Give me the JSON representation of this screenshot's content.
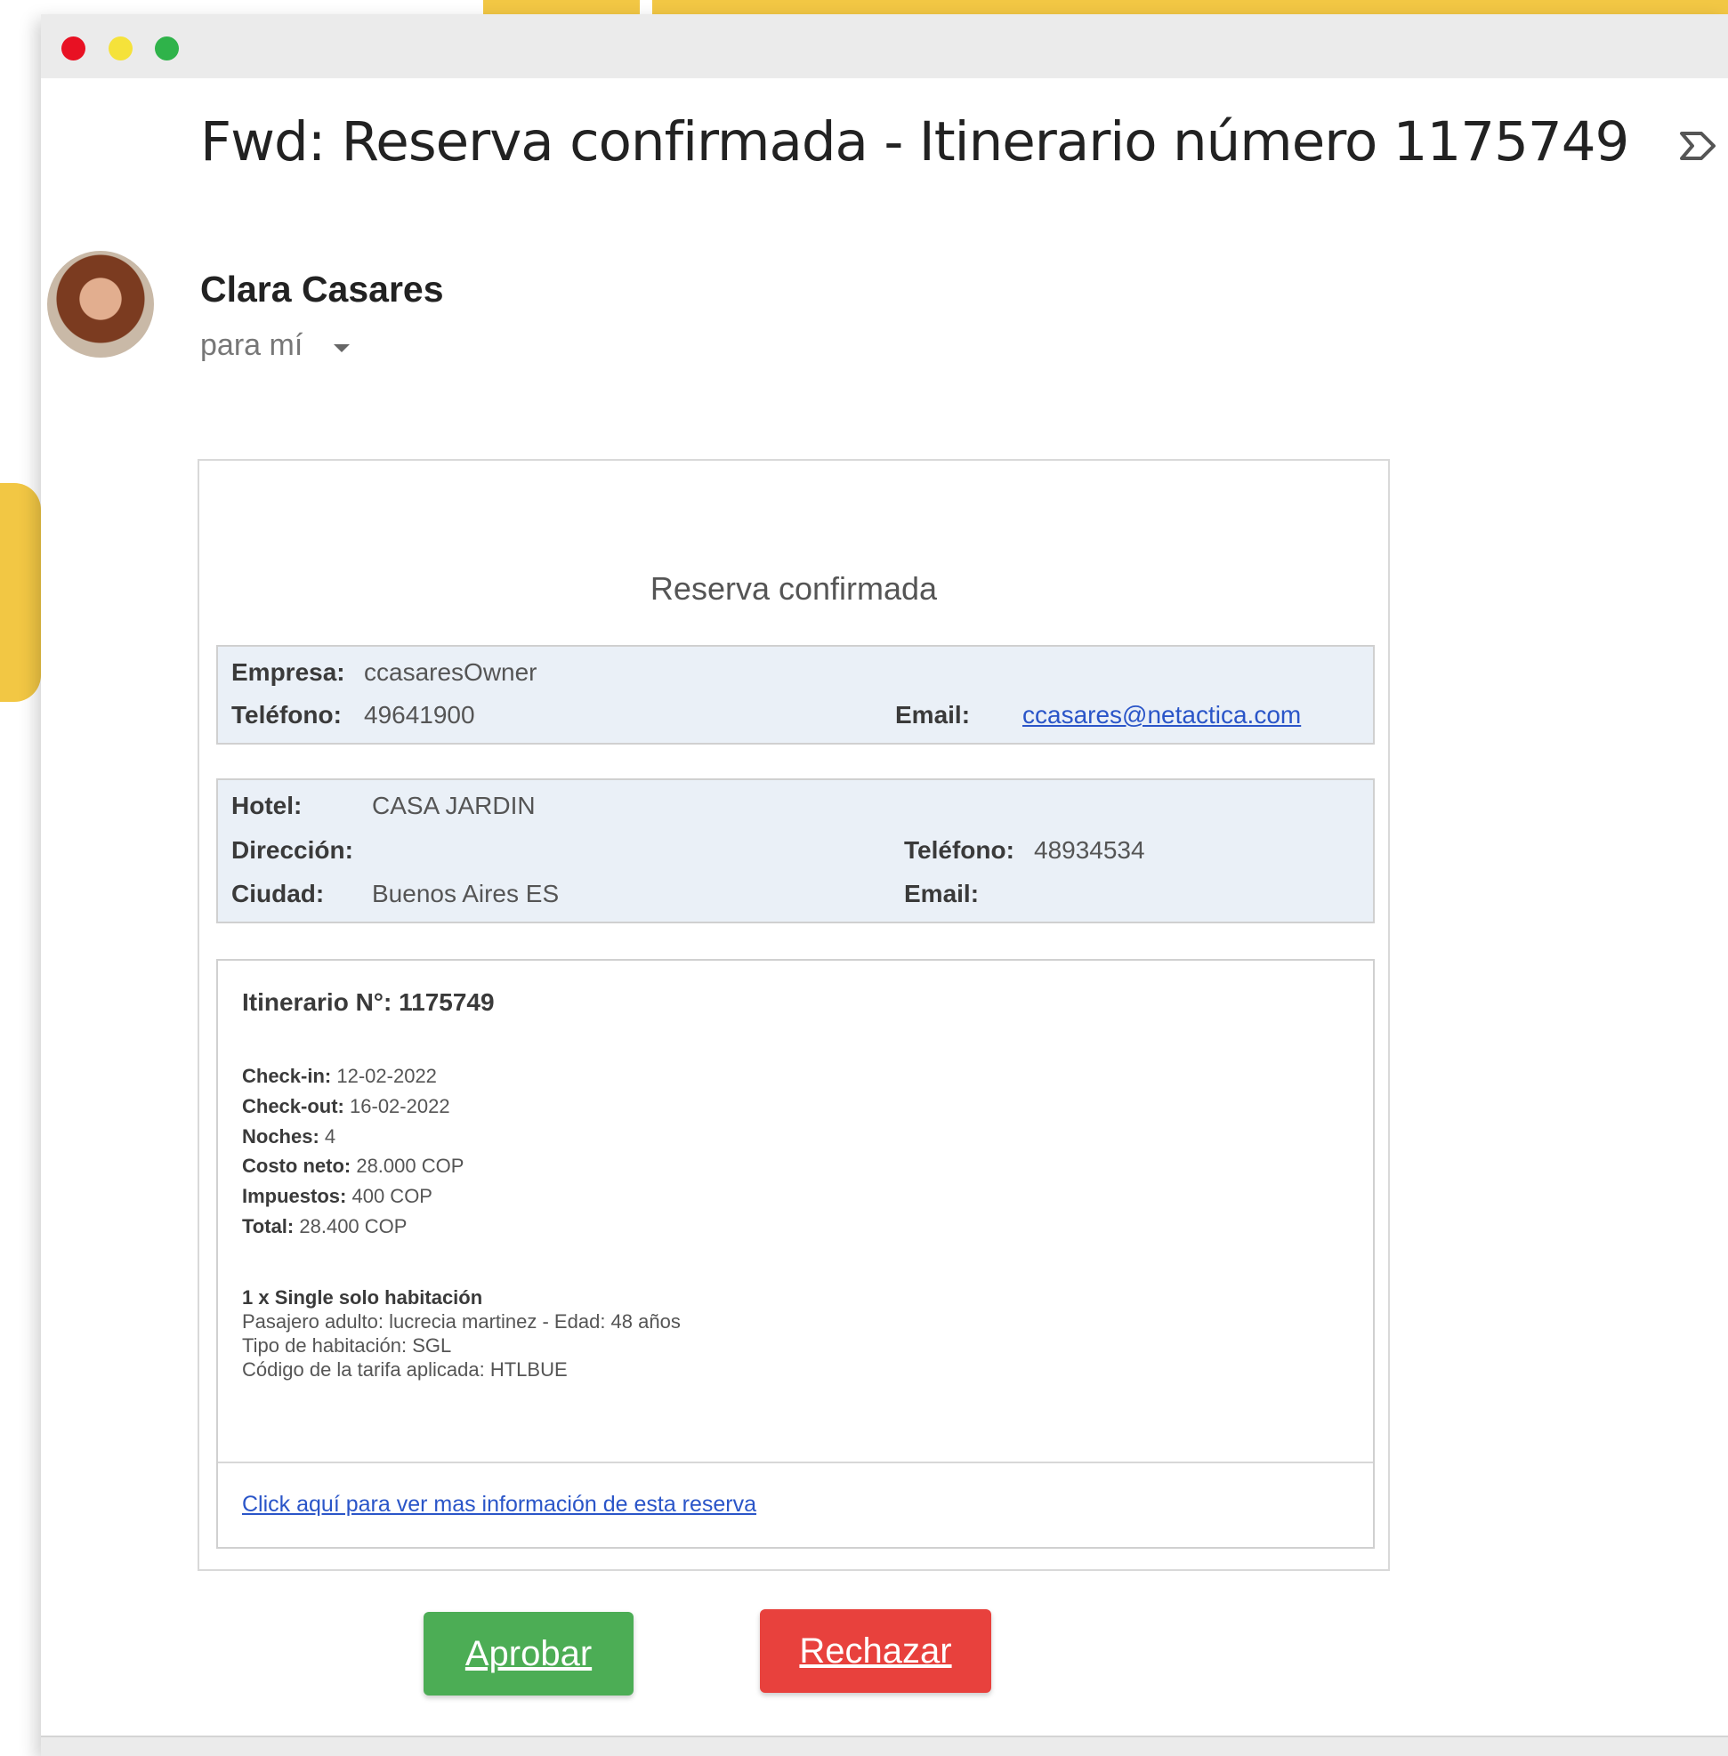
{
  "email": {
    "subject": "Fwd: Reserva confirmada - Itinerario número 1175749",
    "sender": "Clara Casares",
    "recipient": "para mí"
  },
  "card": {
    "title": "Reserva confirmada",
    "company": {
      "empresa_label": "Empresa:",
      "empresa_value": "ccasaresOwner",
      "telefono_label": "Teléfono:",
      "telefono_value": "49641900",
      "email_label": "Email:",
      "email_value": "ccasares@netactica.com"
    },
    "hotel": {
      "hotel_label": "Hotel:",
      "hotel_value": "CASA JARDIN",
      "direccion_label": "Dirección:",
      "ciudad_label": "Ciudad:",
      "ciudad_value": "Buenos Aires ES",
      "telefono_label": "Teléfono:",
      "telefono_value": "48934534",
      "email_label": "Email:"
    },
    "itinerary": {
      "title": "Itinerario N°: 1175749",
      "checkin_label": "Check-in:",
      "checkin_value": "12-02-2022",
      "checkout_label": "Check-out:",
      "checkout_value": "16-02-2022",
      "noches_label": "Noches:",
      "noches_value": "4",
      "costo_label": "Costo neto:",
      "costo_value": "28.000 COP",
      "impuestos_label": "Impuestos:",
      "impuestos_value": "400 COP",
      "total_label": "Total:",
      "total_value": "28.400 COP",
      "room_title": "1 x Single solo habitación",
      "room_passenger": "Pasajero adulto: lucrecia martinez - Edad: 48 años",
      "room_type": "Tipo de habitación: SGL",
      "room_rate": "Código de la tarifa aplicada: HTLBUE",
      "more_info_link": "Click aquí para ver mas información de esta reserva"
    }
  },
  "actions": {
    "approve": "Aprobar",
    "reject": "Rechazar"
  },
  "colors": {
    "accent_yellow": "#f2c744",
    "approve_green": "#4cad55",
    "reject_red": "#e8413d",
    "link_blue": "#2a55c8"
  },
  "icons": [
    "close-dot-icon",
    "minimize-dot-icon",
    "maximize-dot-icon",
    "label-icon",
    "chevron-down-icon"
  ]
}
